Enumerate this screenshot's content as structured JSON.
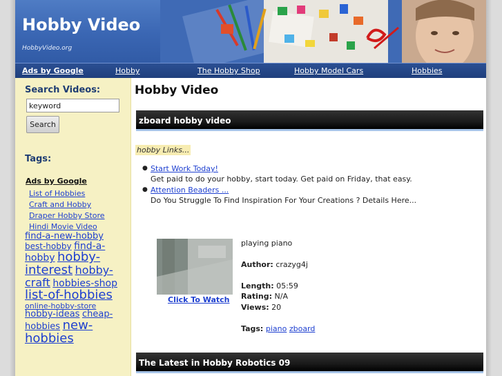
{
  "header": {
    "title": "Hobby Video",
    "url": "HobbyVideo.org"
  },
  "nav": {
    "ads": "Ads by Google",
    "links": [
      "Hobby",
      "The Hobby Shop",
      "Hobby Model Cars",
      "Hobbies"
    ]
  },
  "sidebar": {
    "search_heading": "Search Videos:",
    "search_value": "keyword",
    "search_button": "Search",
    "tags_heading": "Tags:",
    "ads_label": "Ads by Google",
    "ad_links": [
      "List of Hobbies",
      "Craft and Hobby",
      "Draper Hobby Store",
      "Hindi Movie Video"
    ],
    "tags": [
      "find-a-new-hobby",
      "best-hobby",
      "find-a-hobby",
      "hobby-interest",
      "hobby-craft",
      "hobbies-shop",
      "list-of-hobbies",
      "online-hobby-store",
      "hobby-ideas",
      "cheap-hobbies",
      "new-hobbies"
    ]
  },
  "main": {
    "title": "Hobby Video",
    "section1": "zboard hobby video",
    "hobby_links_label": "hobby Links...",
    "links": [
      {
        "title": "Start Work Today!",
        "desc": "Get paid to do your hobby, start today. Get paid on Friday, that easy."
      },
      {
        "title": "Attention Beaders ...",
        "desc": "Do You Struggle To Find Inspiration For Your Creations ? Details Here..."
      }
    ],
    "video": {
      "description": "playing piano",
      "author_label": "Author:",
      "author": "crazyg4j",
      "length_label": "Length:",
      "length": "05:59",
      "rating_label": "Rating:",
      "rating": "N/A",
      "views_label": "Views:",
      "views": "20",
      "tags_label": "Tags:",
      "tags": [
        "piano",
        "zboard"
      ],
      "click_to_watch": "Click To Watch"
    },
    "section2": "The Latest in Hobby Robotics 09"
  },
  "colors": {
    "header_blue": "#3a66b3",
    "nav_blue": "#1f3f7c",
    "sidebar_bg": "#f6f1c4",
    "link_blue": "#1d3fd0",
    "section_bar": "#1a1a1a"
  }
}
